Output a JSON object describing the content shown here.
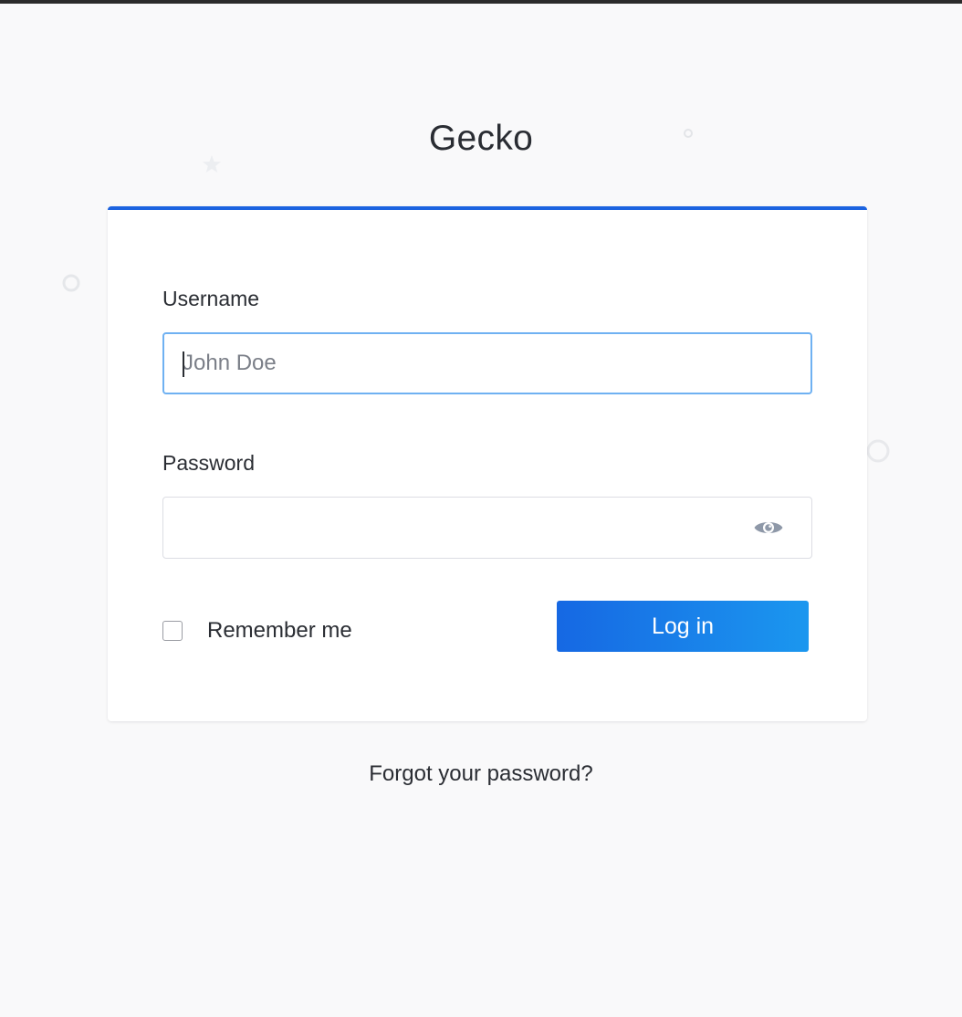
{
  "app": {
    "title": "Gecko"
  },
  "login_form": {
    "username": {
      "label": "Username",
      "placeholder": "John Doe",
      "value": ""
    },
    "password": {
      "label": "Password",
      "value": "",
      "toggle_icon": "eye-icon"
    },
    "remember_me": {
      "label": "Remember me",
      "checked": false
    },
    "submit_label": "Log in",
    "forgot_password_label": "Forgot your password?"
  },
  "decorations": {
    "icons": [
      "star-icon",
      "ring-icon"
    ]
  },
  "colors": {
    "accent": "#1c63e0",
    "button_gradient_start": "#1668e3",
    "button_gradient_end": "#1b97ef",
    "focus_border": "#6fb1f2",
    "background": "#f9f9fa",
    "text": "#2a2d33"
  }
}
